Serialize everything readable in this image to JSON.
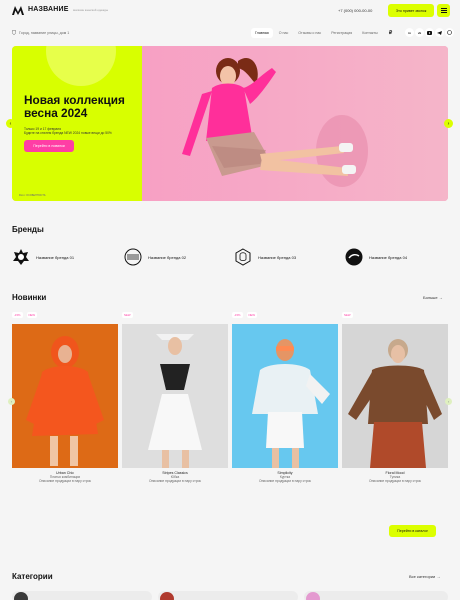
{
  "header": {
    "brand_name": "НАЗВАНИЕ",
    "brand_sub": "магазин женской одежды",
    "phone": "+7 (000) 000-00-00",
    "callback_label": "Это привет звонок"
  },
  "subbar": {
    "address": "Город, название улицы, дом 1",
    "nav": [
      "Главная",
      "О нас",
      "Отзывы о нас",
      "Регистрация",
      "Контакты"
    ],
    "currency_symbol": "₽",
    "socials": [
      "in",
      "vk",
      "yt",
      "tg",
      "wa"
    ]
  },
  "hero": {
    "title": "Новая коллекция весна 2024",
    "desc": "Только 19 и 17 февраля\nБудите на стилем бренда NEW 2024 новые вещи до 50%",
    "button_label": "Перейти в новинки",
    "credit": "Фото: ОСОБЕННОСТЬ"
  },
  "brands": {
    "title": "Бренды",
    "items": [
      {
        "label": "Название бренда 01"
      },
      {
        "label": "Название бренда 02"
      },
      {
        "label": "Название бренда 03"
      },
      {
        "label": "Название бренда 04"
      }
    ]
  },
  "novelties": {
    "title": "Новинки",
    "all_link": "Больше →",
    "products": [
      {
        "badges": [
          "-15%",
          "NEW"
        ],
        "name": "Urban Chic",
        "type": "Платья комбинации",
        "desc": "Описание продукции в пару строк"
      },
      {
        "badges": [
          "NEW"
        ],
        "name": "Stripes Classics",
        "type": "Юбка",
        "desc": "Описание продукции в пару строк"
      },
      {
        "badges": [
          "-15%",
          "NEW"
        ],
        "name": "Simplicity",
        "type": "Куртка",
        "desc": "Описание продукции в пару строк"
      },
      {
        "badges": [
          "NEW"
        ],
        "name": "Floral Mood",
        "type": "Туника",
        "desc": "Описание продукции в пару строк"
      }
    ],
    "catalog_button": "Перейти в каталог"
  },
  "categories": {
    "title": "Категории",
    "all_link": "Все категории →"
  },
  "colors": {
    "accent": "#dcff00",
    "pink": "#ff3ea5"
  }
}
